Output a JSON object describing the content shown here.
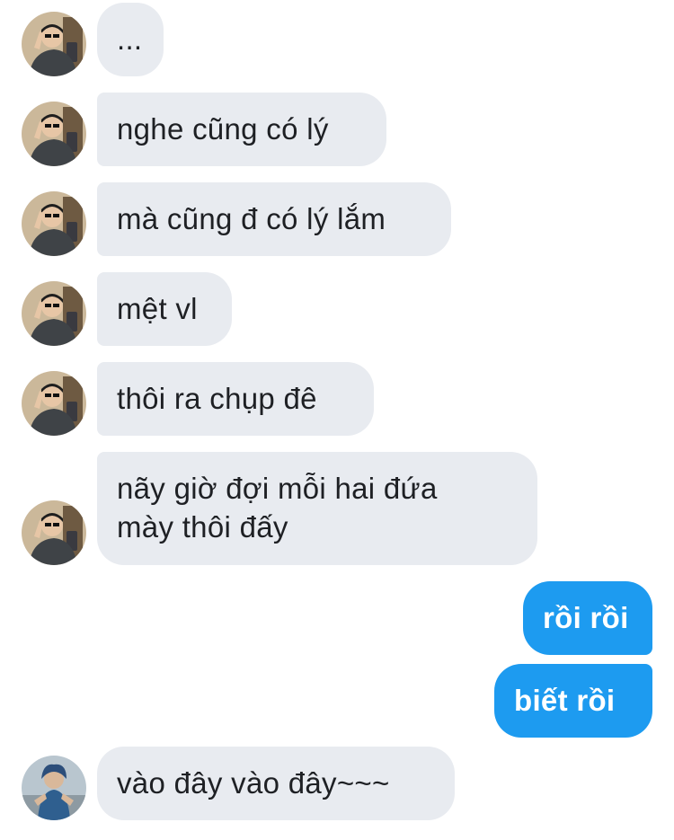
{
  "conversation": {
    "messages": [
      {
        "sender": "contact_a",
        "text": "..."
      },
      {
        "sender": "contact_a",
        "text": "nghe cũng có lý"
      },
      {
        "sender": "contact_a",
        "text": "mà cũng đ có lý lắm"
      },
      {
        "sender": "contact_a",
        "text": "mệt vl"
      },
      {
        "sender": "contact_a",
        "text": "thôi ra chụp đê"
      },
      {
        "sender": "contact_a",
        "text": "nãy giờ đợi mỗi hai đứa\nmày thôi đấy"
      },
      {
        "sender": "me",
        "text": "rồi rồi"
      },
      {
        "sender": "me",
        "text": "biết rồi"
      },
      {
        "sender": "contact_b",
        "text": "vào đây vào đây~~~"
      }
    ]
  },
  "colors": {
    "incoming_bubble": "#e8ebf0",
    "outgoing_bubble": "#1d9bf0",
    "incoming_text": "#1e2024",
    "outgoing_text": "#ffffff"
  }
}
